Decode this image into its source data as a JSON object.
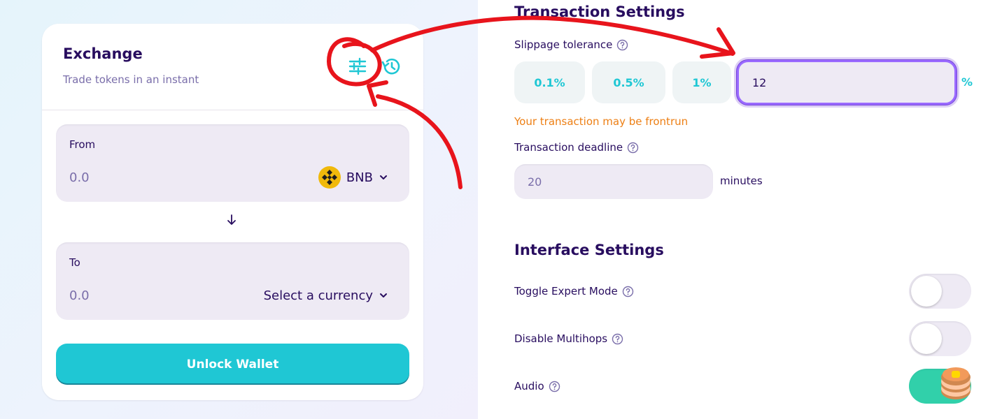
{
  "exchange": {
    "title": "Exchange",
    "subtitle": "Trade tokens in an instant",
    "from": {
      "label": "From",
      "amount": "0.0",
      "token": "BNB"
    },
    "to": {
      "label": "To",
      "amount": "0.0",
      "token": "Select a currency"
    },
    "unlock_label": "Unlock Wallet"
  },
  "settings": {
    "transaction_title": "Transaction Settings",
    "slippage_label": "Slippage tolerance",
    "slippage_options": [
      "0.1%",
      "0.5%",
      "1%"
    ],
    "slippage_value": "12",
    "slippage_unit": "%",
    "warning": "Your transaction may be frontrun",
    "deadline_label": "Transaction deadline",
    "deadline_value": "20",
    "deadline_unit": "minutes",
    "interface_title": "Interface Settings",
    "toggles": [
      {
        "label": "Toggle Expert Mode",
        "on": false
      },
      {
        "label": "Disable Multihops",
        "on": false
      },
      {
        "label": "Audio",
        "on": true
      }
    ]
  },
  "colors": {
    "primary": "#1fc7d4",
    "text": "#280d5f",
    "text_subtle": "#7a6eaa",
    "warning": "#ed7f14",
    "success": "#31d0aa",
    "annotation": "#e8141c"
  }
}
